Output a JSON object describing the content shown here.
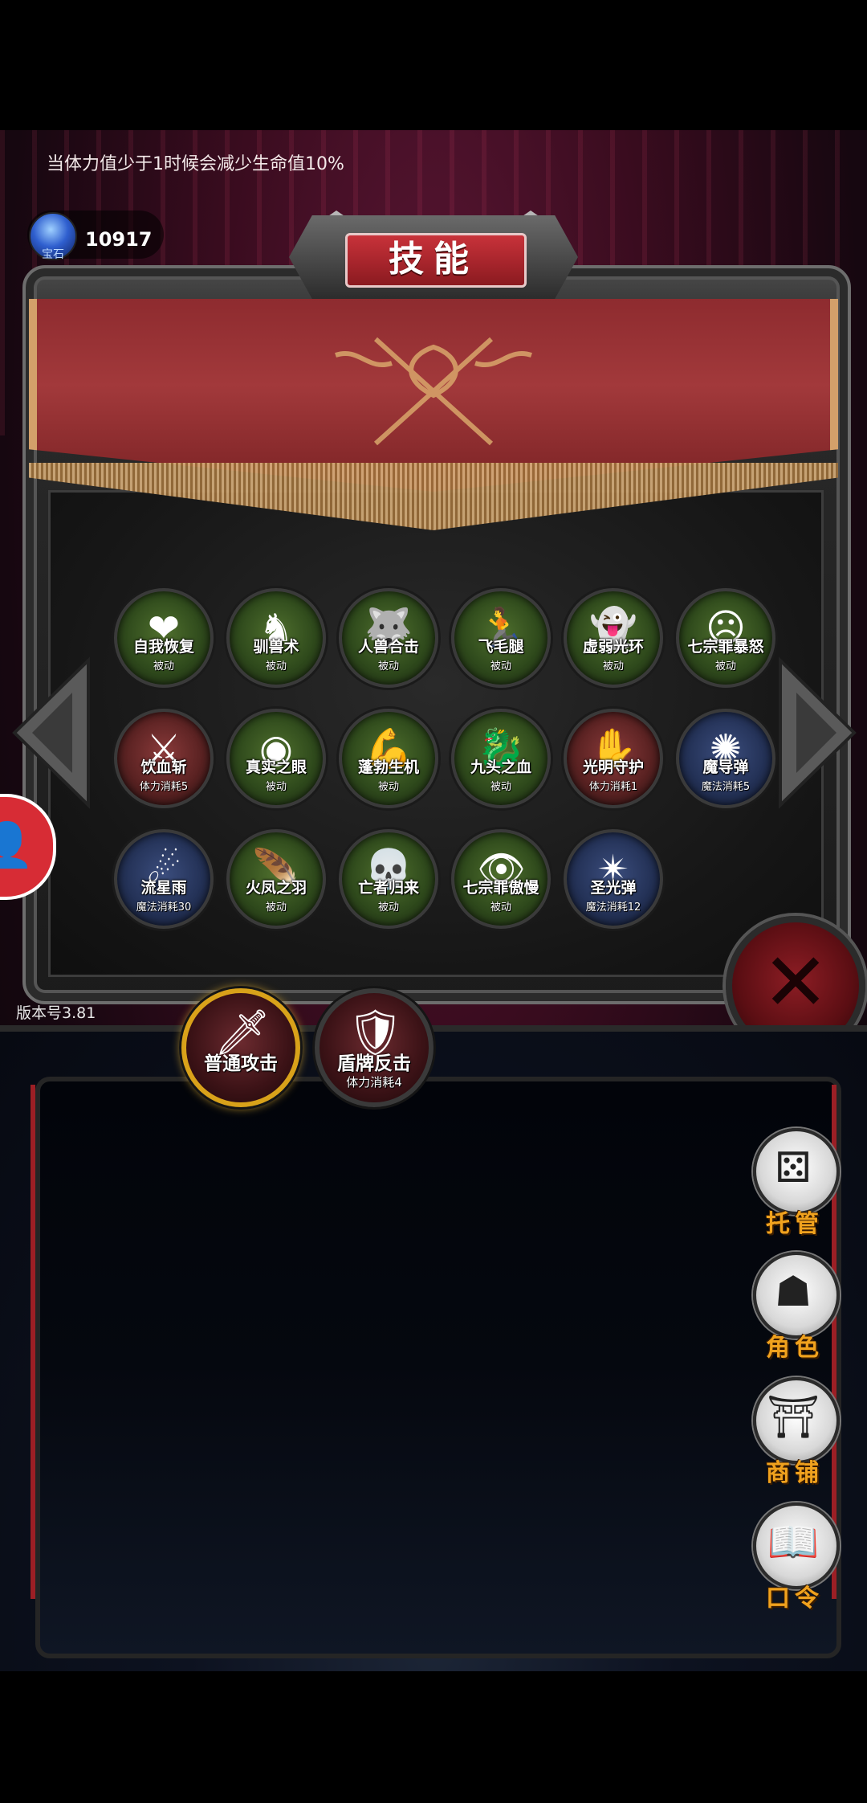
{
  "hint_text": "当体力值少于1时候会减少生命值10%",
  "currency": {
    "label": "宝石",
    "amount": "10917"
  },
  "panel": {
    "title": "技能"
  },
  "skills": [
    {
      "name": "自我恢复",
      "sub": "被动",
      "icon": "heart-icon",
      "glyph": "❤",
      "tint": "green"
    },
    {
      "name": "驯兽术",
      "sub": "被动",
      "icon": "horse-head-icon",
      "glyph": "♞",
      "tint": "green"
    },
    {
      "name": "人兽合击",
      "sub": "被动",
      "icon": "wolf-head-icon",
      "glyph": "🐺",
      "tint": "green"
    },
    {
      "name": "飞毛腿",
      "sub": "被动",
      "icon": "running-man-icon",
      "glyph": "🏃",
      "tint": "green"
    },
    {
      "name": "虚弱光环",
      "sub": "被动",
      "icon": "ghost-icon",
      "glyph": "👻",
      "tint": "green"
    },
    {
      "name": "七宗罪暴怒",
      "sub": "被动",
      "icon": "wrath-face-icon",
      "glyph": "☹",
      "tint": "green"
    },
    {
      "name": "饮血斩",
      "sub": "体力消耗5",
      "icon": "bloody-sword-icon",
      "glyph": "⚔",
      "tint": "red"
    },
    {
      "name": "真实之眼",
      "sub": "被动",
      "icon": "eye-spiral-icon",
      "glyph": "◉",
      "tint": "green"
    },
    {
      "name": "蓬勃生机",
      "sub": "被动",
      "icon": "strongman-icon",
      "glyph": "💪",
      "tint": "green"
    },
    {
      "name": "九头之血",
      "sub": "被动",
      "icon": "hydra-icon",
      "glyph": "🐉",
      "tint": "green"
    },
    {
      "name": "光明守护",
      "sub": "体力消耗1",
      "icon": "sun-hand-icon",
      "glyph": "✋",
      "tint": "red"
    },
    {
      "name": "魔导弹",
      "sub": "魔法消耗5",
      "icon": "energy-orb-icon",
      "glyph": "✺",
      "tint": "blue"
    },
    {
      "name": "流星雨",
      "sub": "魔法消耗30",
      "icon": "meteor-icon",
      "glyph": "☄",
      "tint": "blue"
    },
    {
      "name": "火凤之羽",
      "sub": "被动",
      "icon": "phoenix-feather-icon",
      "glyph": "🪶",
      "tint": "green"
    },
    {
      "name": "亡者归来",
      "sub": "被动",
      "icon": "horned-skull-icon",
      "glyph": "💀",
      "tint": "green"
    },
    {
      "name": "七宗罪傲慢",
      "sub": "被动",
      "icon": "pride-eye-icon",
      "glyph": "👁",
      "tint": "green"
    },
    {
      "name": "圣光弹",
      "sub": "魔法消耗12",
      "icon": "holy-burst-icon",
      "glyph": "✴",
      "tint": "blue"
    }
  ],
  "actions": [
    {
      "name": "普通攻击",
      "sub": "",
      "icon": "sword-slash-icon",
      "glyph": "🗡",
      "active": true
    },
    {
      "name": "盾牌反击",
      "sub": "体力消耗4",
      "icon": "shield-icon",
      "glyph": "🛡",
      "active": false
    }
  ],
  "side_menu": [
    {
      "label": "托管",
      "icon": "dice-icon",
      "glyph": "⚄"
    },
    {
      "label": "角色",
      "icon": "hooded-figure-icon",
      "glyph": "☗"
    },
    {
      "label": "商铺",
      "icon": "shop-sign-icon",
      "glyph": "⛩"
    },
    {
      "label": "口令",
      "icon": "spellbook-icon",
      "glyph": "📖"
    }
  ],
  "version": "版本号3.81",
  "colors": {
    "accent_gold": "#f0a21e",
    "panel_red": "#a2393b",
    "close_red": "#8d1d24"
  }
}
